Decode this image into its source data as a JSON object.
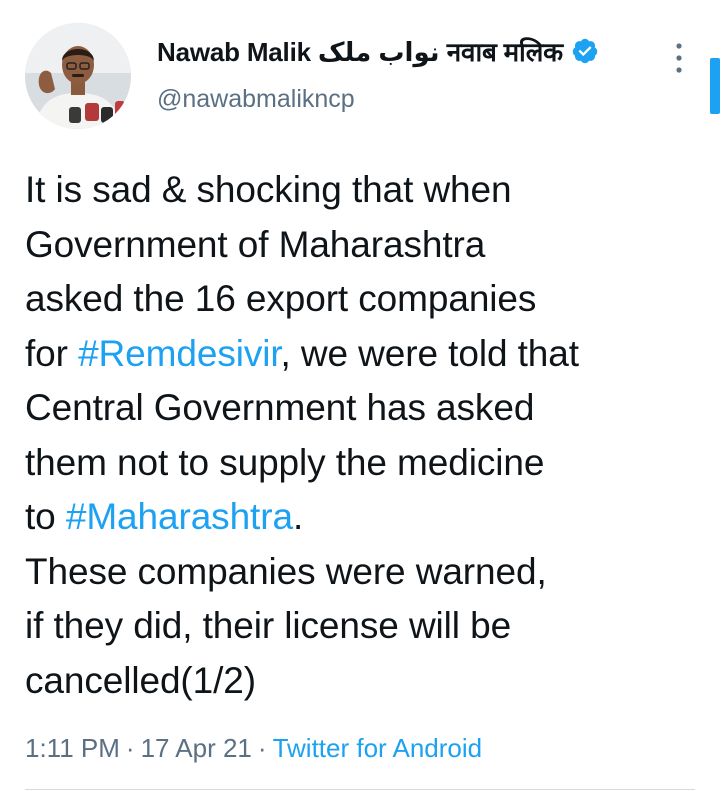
{
  "tweet": {
    "author": {
      "display_name": "Nawab Malik نواب ملک नवाब मलिक",
      "handle": "@nawabmalikncp",
      "verified": true,
      "avatar_icon": "avatar-photo"
    },
    "text_lines": [
      [
        {
          "t": "It is sad & shocking that when"
        }
      ],
      [
        {
          "t": "Government of Maharashtra"
        }
      ],
      [
        {
          "t": "asked the 16 export companies"
        }
      ],
      [
        {
          "t": "for "
        },
        {
          "t": "#Remdesivir",
          "hashtag": true
        },
        {
          "t": ", we were told that"
        }
      ],
      [
        {
          "t": "Central Government has asked"
        }
      ],
      [
        {
          "t": "them not to supply the medicine"
        }
      ],
      [
        {
          "t": "to "
        },
        {
          "t": "#Maharashtra",
          "hashtag": true
        },
        {
          "t": "."
        }
      ],
      [
        {
          "t": "These companies were warned,"
        }
      ],
      [
        {
          "t": "if they did, their license will be"
        }
      ],
      [
        {
          "t": "cancelled(1/2)"
        }
      ]
    ],
    "time": "1:11 PM",
    "date": "17 Apr 21",
    "separator": "·",
    "source": "Twitter for Android"
  },
  "colors": {
    "text": "#0f1419",
    "secondary": "#5b7083",
    "accent": "#1da1f2",
    "divider": "#d9d9d9"
  },
  "icons": {
    "verified": "verified-badge-icon",
    "more": "more-vertical-icon"
  }
}
